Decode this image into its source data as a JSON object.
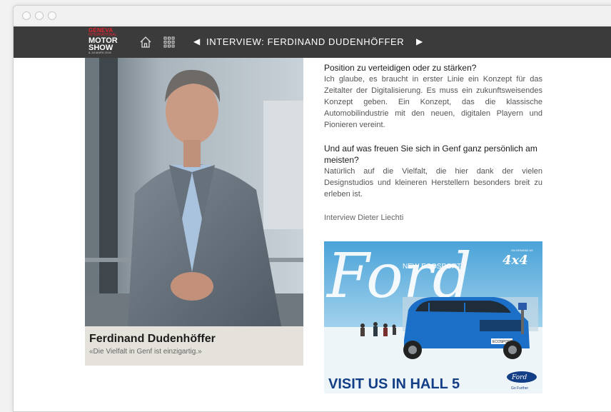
{
  "window": {
    "controls": [
      "close",
      "minimize",
      "maximize"
    ]
  },
  "navbar": {
    "logo": {
      "line1": "GENEVA",
      "line2": "INTERNATIONAL",
      "line3": "MOTOR",
      "line4": "SHOW",
      "line5": "8–18 MARS 2018"
    },
    "home_icon": "home-icon",
    "grid_icon": "grid-icon",
    "prev_icon": "◀",
    "title": "INTERVIEW: FERDINAND DUDENHÖFFER",
    "next_icon": "▶"
  },
  "photo": {
    "caption_name": "Ferdinand Dudenhöffer",
    "caption_quote": "«Die Vielfalt in Genf ist einzigartig.»"
  },
  "article": {
    "q1": "Position zu verteidigen oder zu stärken?",
    "a1": "Ich glaube, es braucht in erster Linie ein Konzept für das Zeitalter der Digitalisierung. Es muss ein zukunftsweisendes Konzept geben. Ein Konzept, das die klassische Automobilindustrie mit den neuen, digitalen Playern und Pionieren vereint.",
    "q2": "Und auf was freuen Sie sich in Genf ganz persönlich am meisten?",
    "a2": "Natürlich auf die Vielfalt, die hier dank der vielen Designstudios und kleineren Herstellern besonders breit zu erleben ist.",
    "credit": "Interview Dieter Liechti"
  },
  "ad": {
    "brand_script": "Ford",
    "model": "NEW ECOSPORT",
    "badge": "4x4",
    "badge_small": "ON DEMAND AS",
    "plate": "ECOSPORT",
    "cta": "VISIT US IN HALL 5",
    "logo_text": "Ford",
    "tagline": "Go Further"
  }
}
